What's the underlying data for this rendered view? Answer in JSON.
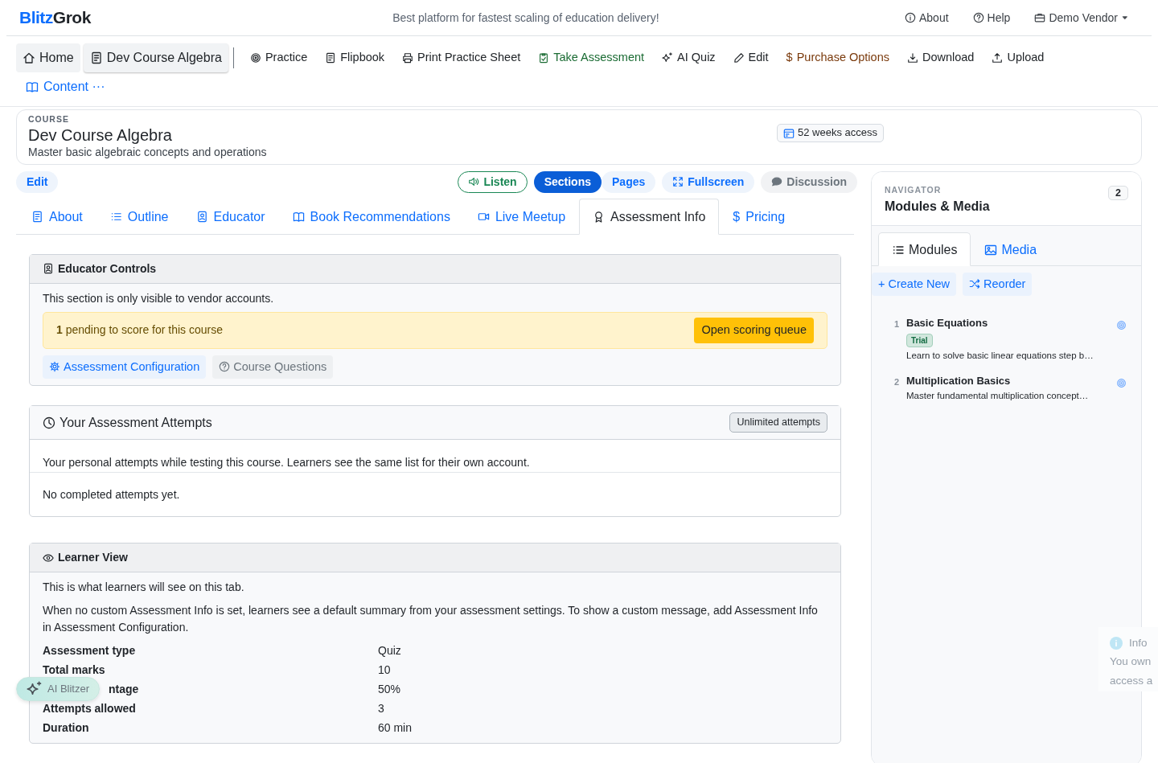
{
  "header": {
    "logo": {
      "part1": "Blitz",
      "part2": "Grok"
    },
    "tagline": "Best platform for fastest scaling of education delivery!",
    "links": [
      {
        "label": "About"
      },
      {
        "label": "Help"
      }
    ],
    "account": {
      "label": "Demo Vendor"
    }
  },
  "toolbar": {
    "items": [
      {
        "label": "Home",
        "kind": "pill",
        "selected": false,
        "color": "#212529"
      },
      {
        "label": "Dev Course Algebra",
        "kind": "pill",
        "selected": true,
        "color": "#212529"
      },
      {
        "label": "Practice",
        "kind": "link",
        "selected": false,
        "color": "#212529"
      },
      {
        "label": "Flipbook",
        "kind": "link",
        "selected": false,
        "color": "#212529"
      },
      {
        "label": "Print Practice Sheet",
        "kind": "link",
        "selected": false,
        "color": "#212529"
      },
      {
        "label": "Take Assessment",
        "kind": "link",
        "selected": false,
        "color": "#1a6b33"
      },
      {
        "label": "AI Quiz",
        "kind": "link",
        "selected": false,
        "color": "#212529"
      },
      {
        "label": "Edit",
        "kind": "link",
        "selected": false,
        "color": "#212529"
      },
      {
        "label": "Purchase Options",
        "kind": "link",
        "selected": false,
        "color": "#7a3a0c",
        "symbol": "$"
      },
      {
        "label": "Download",
        "kind": "link",
        "selected": false,
        "color": "#212529"
      },
      {
        "label": "Upload",
        "kind": "link",
        "selected": false,
        "color": "#212529"
      }
    ],
    "content_menu": {
      "label": "Content",
      "more": "···"
    }
  },
  "course": {
    "eyebrow": "COURSE",
    "title": "Dev Course Algebra",
    "subtitle": "Master basic algebraic concepts and operations",
    "access_badge": "52 weeks access"
  },
  "actions": {
    "edit": "Edit",
    "listen": "Listen",
    "view_toggle": [
      {
        "label": "Sections",
        "selected": true
      },
      {
        "label": "Pages",
        "selected": false
      }
    ],
    "fullscreen": "Fullscreen",
    "discussion": "Discussion"
  },
  "tabs": [
    {
      "label": "About",
      "selected": false
    },
    {
      "label": "Outline",
      "selected": false
    },
    {
      "label": "Educator",
      "selected": false
    },
    {
      "label": "Book Recommendations",
      "selected": false
    },
    {
      "label": "Live Meetup",
      "selected": false
    },
    {
      "label": "Assessment Info",
      "selected": true
    },
    {
      "label": "Pricing",
      "selected": false,
      "symbol": "$"
    }
  ],
  "educator_controls": {
    "title": "Educator Controls",
    "note": "This section is only visible to vendor accounts.",
    "alert": {
      "text": "**1** pending to score for this course",
      "button": "Open scoring queue"
    },
    "buttons": [
      {
        "label": "Assessment Configuration",
        "kind": "primary"
      },
      {
        "label": "Course Questions",
        "kind": "muted"
      }
    ]
  },
  "attempts": {
    "title": "Your Assessment Attempts",
    "badge": "Unlimited attempts",
    "description": "Your personal attempts while testing this course. Learners see the same list for their own account.",
    "empty": "No completed attempts yet."
  },
  "learner_view": {
    "title": "Learner View",
    "intro": "This is what learners will see on this tab.",
    "paragraph": "When no custom Assessment Info is set, learners see a default summary from your assessment settings. To show a custom message, add Assessment Info in Assessment Configuration.",
    "details": [
      {
        "label": "Assessment type",
        "value": "Quiz"
      },
      {
        "label": "Total marks",
        "value": "10"
      },
      {
        "label": "ntage",
        "value": "50%",
        "covered": true
      },
      {
        "label": "Attempts allowed",
        "value": "3"
      },
      {
        "label": "Duration",
        "value": "60 min"
      }
    ]
  },
  "navigator": {
    "eyebrow": "NAVIGATOR",
    "title": "Modules & Media",
    "count": "2",
    "tabs": [
      {
        "label": "Modules",
        "selected": true
      },
      {
        "label": "Media",
        "selected": false
      }
    ],
    "actions": [
      {
        "label": "+ Create New"
      },
      {
        "label": "Reorder"
      }
    ],
    "modules": [
      {
        "number": "1",
        "title": "Basic Equations",
        "badge": "Trial",
        "description": "Learn to solve basic linear equations step b…"
      },
      {
        "number": "2",
        "title": "Multiplication Basics",
        "description": "Master fundamental multiplication concept…"
      }
    ]
  },
  "ai_button": {
    "label": "AI Blitzer"
  },
  "toast": {
    "title": "Info",
    "lines": [
      "You own",
      "access a"
    ]
  }
}
